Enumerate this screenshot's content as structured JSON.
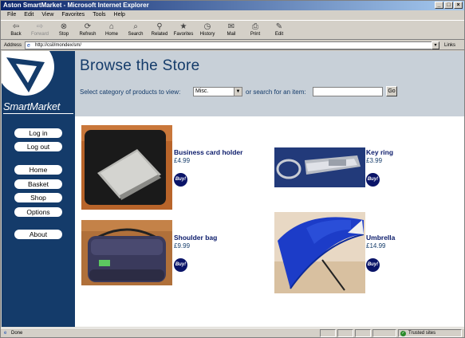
{
  "window": {
    "title": "Aston SmartMarket - Microsoft Internet Explorer"
  },
  "menu": [
    "File",
    "Edit",
    "View",
    "Favorites",
    "Tools",
    "Help"
  ],
  "toolbar": [
    {
      "label": "Back",
      "icon": "back-arrow-icon",
      "disabled": false
    },
    {
      "label": "Forward",
      "icon": "forward-arrow-icon",
      "disabled": true
    },
    {
      "label": "Stop",
      "icon": "stop-icon",
      "disabled": false
    },
    {
      "label": "Refresh",
      "icon": "refresh-icon",
      "disabled": false
    },
    {
      "label": "Home",
      "icon": "home-icon",
      "disabled": false
    },
    {
      "label": "Search",
      "icon": "search-icon",
      "disabled": false
    },
    {
      "label": "Related",
      "icon": "related-icon",
      "disabled": false
    },
    {
      "label": "Favorites",
      "icon": "favorites-icon",
      "disabled": false
    },
    {
      "label": "History",
      "icon": "history-icon",
      "disabled": false
    },
    {
      "label": "Mail",
      "icon": "mail-icon",
      "disabled": false
    },
    {
      "label": "Print",
      "icon": "print-icon",
      "disabled": false
    },
    {
      "label": "Edit",
      "icon": "edit-icon",
      "disabled": false
    }
  ],
  "address": {
    "label": "Address",
    "url": "http://csil/mondex/sm/",
    "links": "Links"
  },
  "brand": {
    "name": "SmartMarket"
  },
  "nav": [
    "Log in",
    "Log out",
    "Home",
    "Basket",
    "Shop",
    "Options",
    "About"
  ],
  "header": {
    "title": "Browse the Store",
    "prompt": "Select category of products to view:",
    "category": "Misc.",
    "search_prompt": "or search for an item:",
    "search_value": "",
    "go": "Go"
  },
  "products": [
    {
      "name": "Business card holder",
      "price": "£4.99",
      "buy": "Buy!"
    },
    {
      "name": "Key ring",
      "price": "£3.99",
      "buy": "Buy!"
    },
    {
      "name": "Shoulder bag",
      "price": "£9.99",
      "buy": "Buy!"
    },
    {
      "name": "Umbrella",
      "price": "£14.99",
      "buy": "Buy!"
    }
  ],
  "status": {
    "text": "Done",
    "zone": "Trusted sites"
  }
}
